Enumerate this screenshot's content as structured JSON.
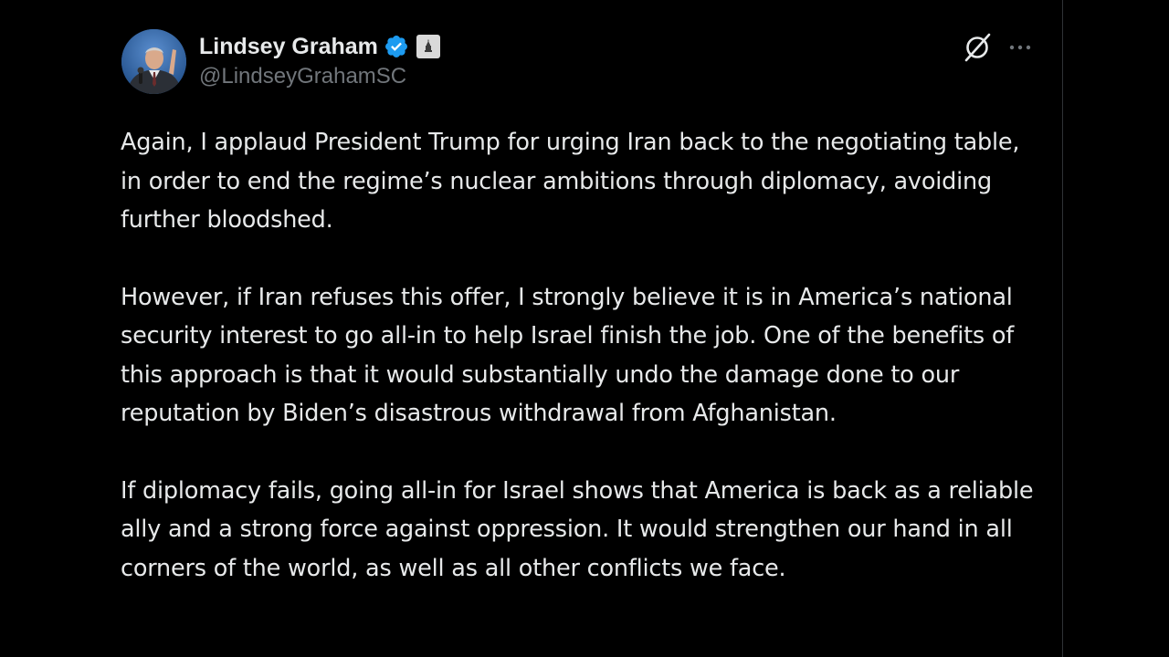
{
  "post": {
    "author": {
      "display_name": "Lindsey Graham",
      "handle": "@LindseyGrahamSC",
      "avatar_icon": "profile-photo",
      "verified_icon": "verified-badge-icon",
      "affiliation_icon": "government-building-icon"
    },
    "actions": {
      "grok_icon": "grok-icon",
      "more_icon": "more-options-icon"
    },
    "paragraphs": [
      "Again, I applaud President Trump for urging Iran back to the negotiating table, in order to end the regime’s nuclear ambitions through diplomacy, avoiding further bloodshed.",
      "However, if Iran refuses this offer, I strongly believe it is in America’s national security interest to go all-in to help Israel finish the job. One of the benefits of this approach is that it would substantially undo the damage done to our reputation by Biden’s disastrous withdrawal from Afghanistan.",
      "If diplomacy fails, going all-in for Israel shows that America is back as a reliable ally and a strong force against oppression. It would strengthen our hand in all corners of the world, as well as all other conflicts we face."
    ]
  },
  "colors": {
    "background": "#000000",
    "text": "#e7e9ea",
    "secondary": "#71767b",
    "verified_blue": "#1d9bf0",
    "divider": "#2f3336"
  }
}
